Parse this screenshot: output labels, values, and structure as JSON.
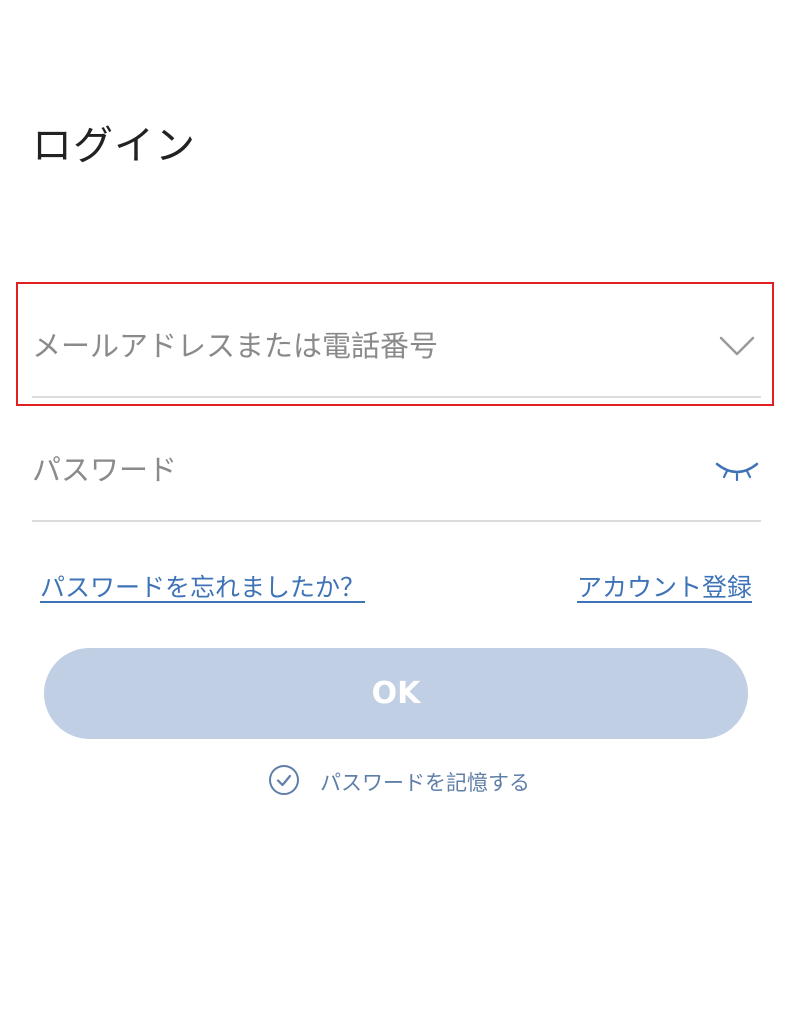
{
  "page": {
    "title": "ログイン"
  },
  "form": {
    "email_placeholder": "メールアドレスまたは電話番号",
    "email_value": "",
    "password_placeholder": "パスワード",
    "password_value": ""
  },
  "links": {
    "forgot_password": "パスワードを忘れましたか？",
    "register": "アカウント登録"
  },
  "actions": {
    "ok_label": "OK",
    "remember_label": "パスワードを記憶する"
  },
  "icons": {
    "email_dropdown": "chevron-down-icon",
    "password_visibility": "eye-closed-icon",
    "remember_check": "check-circle-icon"
  },
  "colors": {
    "accent": "#3f73b8",
    "ok_button_bg": "#c0cfe4",
    "highlight": "#e02020"
  }
}
